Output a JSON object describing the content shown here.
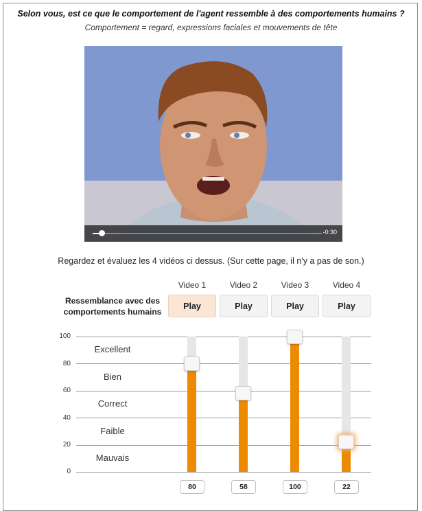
{
  "question": "Selon vous, est ce que le comportement de l'agent ressemble à des comportements humains ?",
  "subquestion": "Comportement = regard, expressions faciales et mouvements de tête",
  "video_player": {
    "time_remaining": "-0:30",
    "progress": 0.04
  },
  "instructions": "Regardez et évaluez les 4 vidéos ci dessus. (Sur cette page, il n'y a pas de son.)",
  "rating": {
    "row_label_line1": "Ressemblance avec des",
    "row_label_line2": "comportements humains",
    "videos": [
      {
        "label": "Video 1",
        "play": "Play",
        "value": 80,
        "active": true
      },
      {
        "label": "Video 2",
        "play": "Play",
        "value": 58,
        "active": false
      },
      {
        "label": "Video 3",
        "play": "Play",
        "value": 100,
        "active": false
      },
      {
        "label": "Video 4",
        "play": "Play",
        "value": 22,
        "active": false,
        "focused": true
      }
    ],
    "scale_ticks": [
      100,
      80,
      60,
      40,
      20,
      0
    ],
    "bands": [
      "Excellent",
      "Bien",
      "Correct",
      "Faible",
      "Mauvais"
    ],
    "fill_color": "#ee8a00",
    "track_color": "#e6e6e6"
  }
}
